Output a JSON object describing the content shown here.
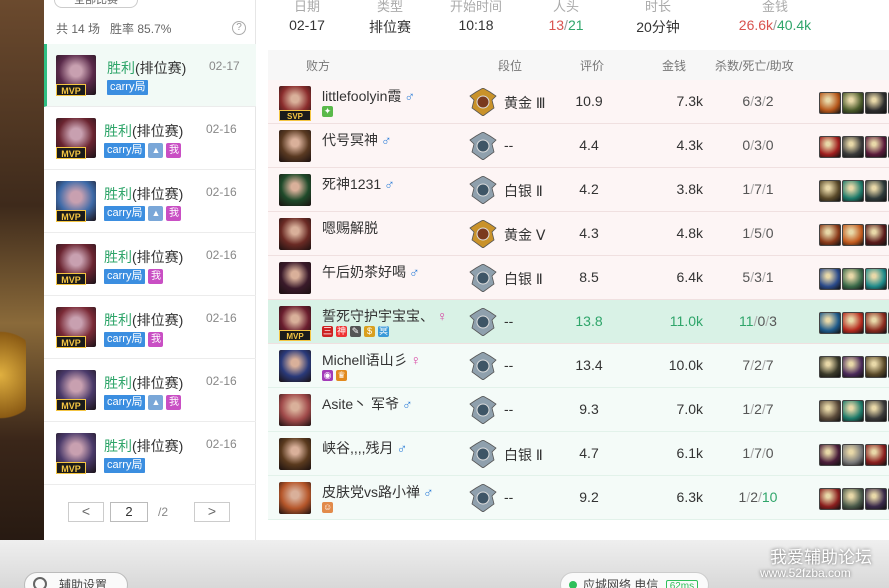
{
  "filter": {
    "label": "全部比赛"
  },
  "summary": {
    "games": "共 14 场",
    "winrate": "胜率 85.7%"
  },
  "match_list": [
    {
      "result": "胜利",
      "mode": "(排位赛)",
      "date": "02-17",
      "mvp": true,
      "carry": "carry局",
      "img": false,
      "me": false,
      "active": true,
      "champ_color": "#5a2a4a"
    },
    {
      "result": "胜利",
      "mode": "(排位赛)",
      "date": "02-16",
      "mvp": true,
      "carry": "carry局",
      "img": true,
      "me": true,
      "active": false,
      "champ_color": "#6a2430"
    },
    {
      "result": "胜利",
      "mode": "(排位赛)",
      "date": "02-16",
      "mvp": true,
      "carry": "carry局",
      "img": true,
      "me": true,
      "active": false,
      "champ_color": "#3d6aa8"
    },
    {
      "result": "胜利",
      "mode": "(排位赛)",
      "date": "02-16",
      "mvp": true,
      "carry": "carry局",
      "img": false,
      "me": true,
      "active": false,
      "champ_color": "#6a2430"
    },
    {
      "result": "胜利",
      "mode": "(排位赛)",
      "date": "02-16",
      "mvp": true,
      "carry": "carry局",
      "img": false,
      "me": true,
      "active": false,
      "champ_color": "#7a2a36"
    },
    {
      "result": "胜利",
      "mode": "(排位赛)",
      "date": "02-16",
      "mvp": true,
      "carry": "carry局",
      "img": true,
      "me": true,
      "active": false,
      "champ_color": "#4a3a6a"
    },
    {
      "result": "胜利",
      "mode": "(排位赛)",
      "date": "02-16",
      "mvp": true,
      "carry": "carry局",
      "img": false,
      "me": false,
      "active": false,
      "champ_color": "#4a3a6a"
    }
  ],
  "pager": {
    "prev": "<",
    "current": "2",
    "total": "/2",
    "next": ">"
  },
  "game_info": {
    "date_label": "日期",
    "date": "02-17",
    "type_label": "类型",
    "type": "排位赛",
    "start_label": "开始时间",
    "start": "10:18",
    "players_label": "人头",
    "players_a": "13",
    "players_sep": "/",
    "players_b": "21",
    "duration_label": "时长",
    "duration": "20分钟",
    "gold_label": "金钱",
    "gold_a": "26.6k",
    "gold_sep": "/",
    "gold_b": "40.4k"
  },
  "table_headers": {
    "team": "败方",
    "rank": "段位",
    "score": "评价",
    "gold": "金钱",
    "kda": "杀数/死亡/助攻"
  },
  "players": [
    {
      "name": "littlefoolyin霞",
      "gender": "♂",
      "svp": true,
      "badges": [
        {
          "t": "✦",
          "c": "#5ab94a"
        }
      ],
      "rank_tier": "gold",
      "rank": "黄金 Ⅲ",
      "score": "10.9",
      "gold": "7.3k",
      "k": "6",
      "d": "3",
      "a": "2",
      "team": "lose",
      "avatar": "#8a2c2c",
      "items": [
        "#b5561a",
        "#4a5a2a",
        "#2e2e2e",
        "#3a6a2a"
      ]
    },
    {
      "name": "代号冥神",
      "gender": "♂",
      "svp": false,
      "badges": [],
      "rank_tier": "silver",
      "rank": "--",
      "score": "4.4",
      "gold": "4.3k",
      "k": "0",
      "d": "3",
      "a": "0",
      "team": "lose",
      "avatar": "#5a3a22",
      "items": [
        "#a01e1e",
        "#3a3a3a",
        "#5a1a3a",
        "#6a4a2a"
      ]
    },
    {
      "name": "死神1231",
      "gender": "♂",
      "svp": false,
      "badges": [],
      "rank_tier": "silver",
      "rank": "白银 Ⅱ",
      "score": "4.2",
      "gold": "3.8k",
      "k": "1",
      "d": "7",
      "a": "1",
      "team": "lose",
      "avatar": "#1f4a2a",
      "items": [
        "#5a4a2a",
        "#1e7a6a",
        "#2e3a3a",
        "#c2a01e"
      ]
    },
    {
      "name": "嗯赐解脱",
      "gender": "",
      "svp": false,
      "badges": [],
      "rank_tier": "gold",
      "rank": "黄金 Ⅴ",
      "score": "4.3",
      "gold": "4.8k",
      "k": "1",
      "d": "5",
      "a": "0",
      "team": "lose",
      "avatar": "#6a2a24",
      "items": [
        "#8a3a1a",
        "#c25a1e",
        "#5a1a1a",
        "#7a6a5a"
      ]
    },
    {
      "name": "午后奶茶好喝",
      "gender": "♂",
      "svp": false,
      "badges": [],
      "rank_tier": "silver",
      "rank": "白银 Ⅱ",
      "score": "8.5",
      "gold": "6.4k",
      "k": "5",
      "d": "3",
      "a": "1",
      "team": "lose",
      "avatar": "#3a1a2a",
      "items": [
        "#2a4a8a",
        "#3a6a4a",
        "#1e8a8a",
        "#2a5a6a"
      ]
    },
    {
      "name": "誓死守护宇宝宝、",
      "gender": "♀",
      "svp": false,
      "mvp": true,
      "badges": [
        {
          "t": "三",
          "c": "#c22"
        },
        {
          "t": "神",
          "c": "#e33"
        },
        {
          "t": "✎",
          "c": "#555"
        },
        {
          "t": "$",
          "c": "#d9a01e"
        },
        {
          "t": "冥",
          "c": "#3a9ad8"
        }
      ],
      "rank_tier": "silver",
      "rank": "--",
      "score": "13.8",
      "gold": "11.0k",
      "k": "11",
      "d": "0",
      "a": "3",
      "team": "me",
      "avatar": "#6a1e2e",
      "items": [
        "#1e5a8a",
        "#b52a1e",
        "#8a2a1e",
        "#c24a1e"
      ]
    },
    {
      "name": "Michell语山彡",
      "gender": "♀",
      "svp": false,
      "badges": [
        {
          "t": "◉",
          "c": "#a23ab8"
        },
        {
          "t": "♛",
          "c": "#e28a1e"
        }
      ],
      "rank_tier": "silver",
      "rank": "--",
      "score": "13.4",
      "gold": "10.0k",
      "k": "7",
      "d": "2",
      "a": "7",
      "team": "win",
      "avatar": "#2a3a7a",
      "items": [
        "#3a3a2a",
        "#4a2a5a",
        "#5a4a2a",
        "#3a3a5a"
      ]
    },
    {
      "name": "Asite丶 军爷",
      "gender": "♂",
      "svp": false,
      "badges": [],
      "rank_tier": "silver",
      "rank": "--",
      "score": "9.3",
      "gold": "7.0k",
      "k": "1",
      "d": "2",
      "a": "7",
      "team": "win",
      "avatar": "#a04a4a",
      "items": [
        "#5a4a3a",
        "#1e7a6a",
        "#3a3a3a",
        "#8a1e2a"
      ]
    },
    {
      "name": "峡谷,,,,残月",
      "gender": "♂",
      "svp": false,
      "badges": [],
      "rank_tier": "silver",
      "rank": "白银 Ⅱ",
      "score": "4.7",
      "gold": "6.1k",
      "k": "1",
      "d": "7",
      "a": "0",
      "team": "win",
      "avatar": "#5a3a1e",
      "items": [
        "#4a1e3a",
        "#7a7a7a",
        "#8a1e1e",
        "#3a3a3a"
      ]
    },
    {
      "name": "皮肤党vs路小禅",
      "gender": "♂",
      "svp": false,
      "badges": [
        {
          "t": "☺",
          "c": "#e28a4a"
        }
      ],
      "rank_tier": "silver",
      "rank": "--",
      "score": "9.2",
      "gold": "6.3k",
      "k": "1",
      "d": "2",
      "a": "10",
      "team": "win",
      "avatar": "#b5562a",
      "items": [
        "#8a1e1e",
        "#4a5a4a",
        "#3a2a4a",
        "#6a5a3a"
      ]
    }
  ],
  "bottom": {
    "settings": "辅助设置",
    "network": "应城网络 电信",
    "ping": "62ms"
  },
  "watermark": {
    "line1": "我爱辅助论坛",
    "line2": "www.52fzba.com"
  },
  "colors": {
    "win": "#2fa56a",
    "lose": "#d9534f",
    "accent": "#2fbf83",
    "carry": "#3b8ee0",
    "me_tag": "#c94fc4"
  }
}
